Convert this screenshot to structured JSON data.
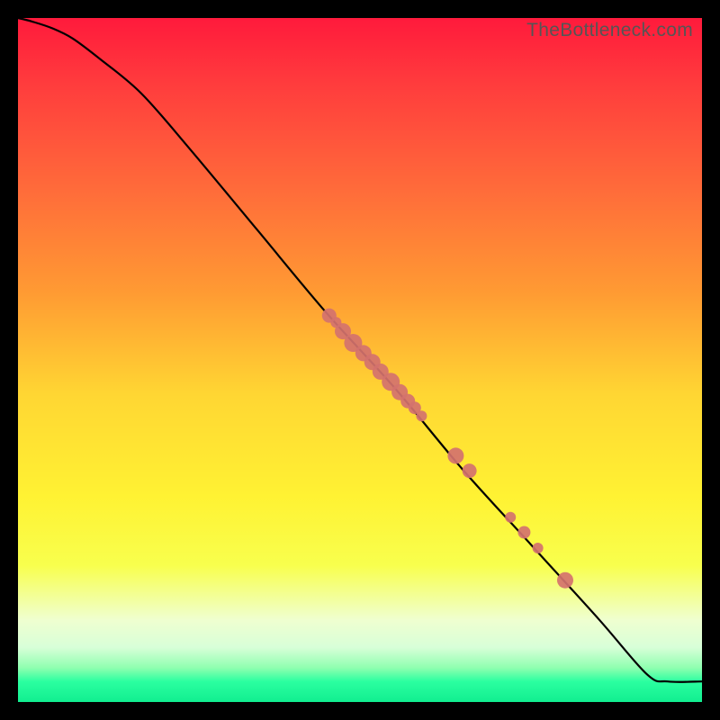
{
  "watermark": "TheBottleneck.com",
  "chart_data": {
    "type": "line",
    "title": "",
    "xlabel": "",
    "ylabel": "",
    "xlim": [
      0,
      1
    ],
    "ylim": [
      0,
      1
    ],
    "background_gradient": {
      "top": "#ff1a3c",
      "middle": "#fff233",
      "bottom": "#11ee90"
    },
    "series": [
      {
        "name": "curve",
        "color": "#000000",
        "x": [
          0.0,
          0.02,
          0.05,
          0.08,
          0.12,
          0.18,
          0.25,
          0.35,
          0.45,
          0.55,
          0.65,
          0.75,
          0.85,
          0.92,
          0.95,
          1.0
        ],
        "y": [
          1.0,
          0.995,
          0.985,
          0.97,
          0.94,
          0.89,
          0.81,
          0.69,
          0.57,
          0.46,
          0.34,
          0.23,
          0.12,
          0.04,
          0.03,
          0.03
        ]
      }
    ],
    "markers": {
      "name": "points",
      "color": "#d4726e",
      "points": [
        {
          "x": 0.455,
          "y": 0.565,
          "r": 8
        },
        {
          "x": 0.465,
          "y": 0.555,
          "r": 6
        },
        {
          "x": 0.475,
          "y": 0.542,
          "r": 9
        },
        {
          "x": 0.49,
          "y": 0.525,
          "r": 10
        },
        {
          "x": 0.505,
          "y": 0.51,
          "r": 9
        },
        {
          "x": 0.518,
          "y": 0.497,
          "r": 9
        },
        {
          "x": 0.53,
          "y": 0.483,
          "r": 9
        },
        {
          "x": 0.545,
          "y": 0.468,
          "r": 10
        },
        {
          "x": 0.558,
          "y": 0.453,
          "r": 9
        },
        {
          "x": 0.57,
          "y": 0.44,
          "r": 8
        },
        {
          "x": 0.58,
          "y": 0.43,
          "r": 7
        },
        {
          "x": 0.59,
          "y": 0.418,
          "r": 6
        },
        {
          "x": 0.64,
          "y": 0.36,
          "r": 9
        },
        {
          "x": 0.66,
          "y": 0.338,
          "r": 8
        },
        {
          "x": 0.72,
          "y": 0.27,
          "r": 6
        },
        {
          "x": 0.74,
          "y": 0.248,
          "r": 7
        },
        {
          "x": 0.76,
          "y": 0.225,
          "r": 6
        },
        {
          "x": 0.8,
          "y": 0.178,
          "r": 9
        }
      ]
    }
  }
}
